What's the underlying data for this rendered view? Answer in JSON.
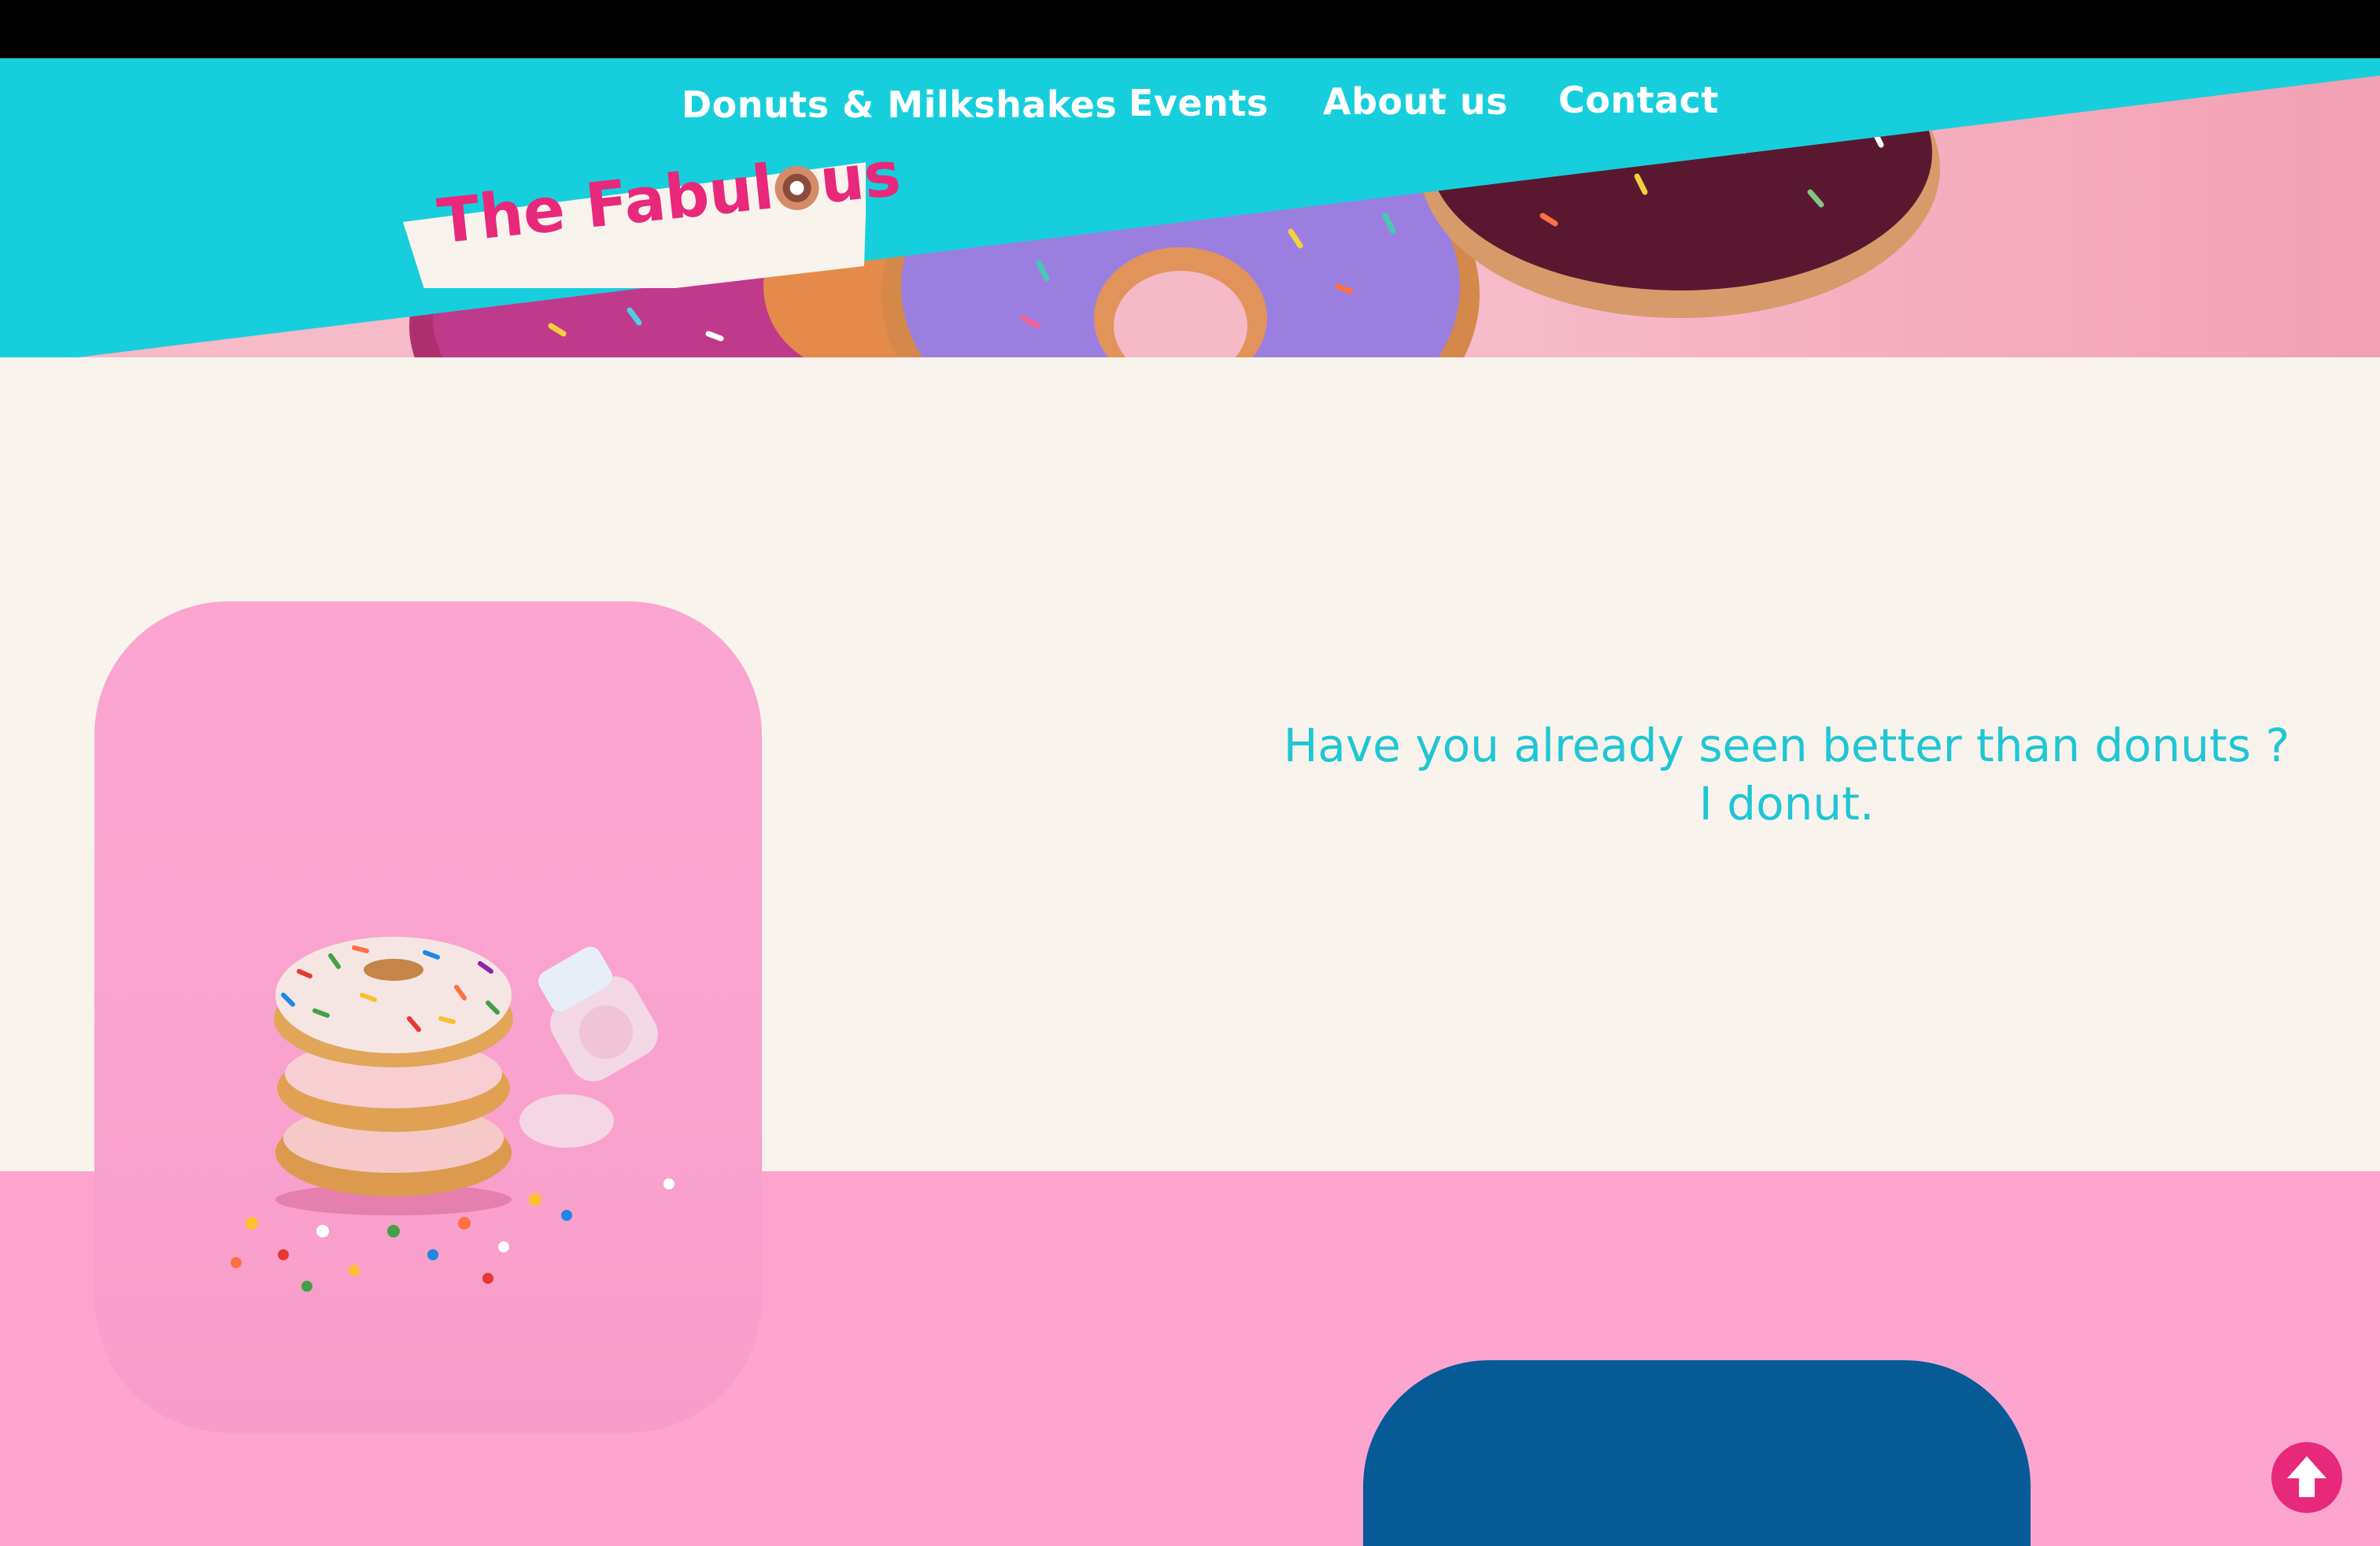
{
  "nav": {
    "items": [
      {
        "label": "Donuts & Milkshakes"
      },
      {
        "label": "Events"
      },
      {
        "label": "About us"
      },
      {
        "label": "Contact"
      }
    ]
  },
  "logo": {
    "text_before": "The Fabul",
    "text_after": "us"
  },
  "intro": {
    "tagline_line1": "Have you already seen better than donuts ?",
    "tagline_line2": "I donut."
  },
  "colors": {
    "teal": "#17cfdc",
    "pink_brand": "#e8287a",
    "pink_section": "#fda4cf",
    "cream": "#f8f3ec",
    "blue_card": "#065a96"
  },
  "icons": {
    "scroll_top": "arrow-up-icon",
    "logo_donut": "donut-icon"
  }
}
